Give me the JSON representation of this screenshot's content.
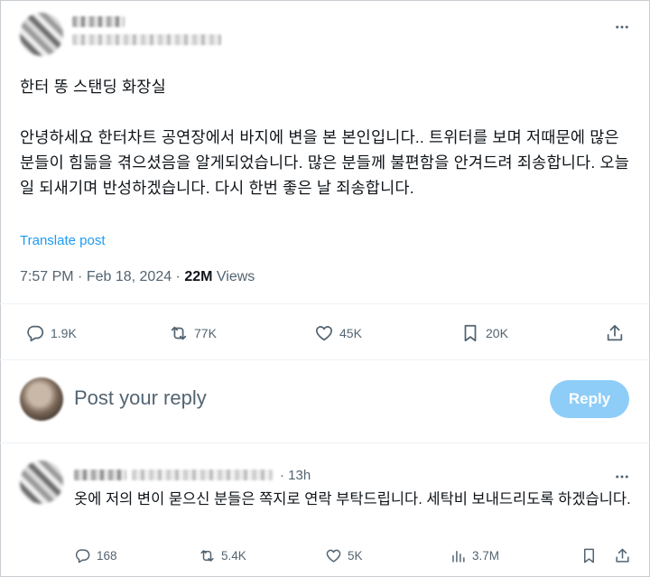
{
  "post": {
    "title": "한터 똥 스탠딩 화장실",
    "body": "안녕하세요 한터차트 공연장에서 바지에 변을 본 본인입니다.. 트위터를 보며 저때문에 많은 분들이 힘듦을 겪으셨음을 알게되었습니다. 많은 분들께 불편함을 안겨드려 죄송합니다. 오늘 일 되새기며 반성하겠습니다. 다시 한번 좋은 날 죄송합니다.",
    "translate_label": "Translate post",
    "time": "7:57 PM",
    "date": "Feb 18, 2024",
    "views_count": "22M",
    "views_label": "Views",
    "replies": "1.9K",
    "reposts": "77K",
    "likes": "45K",
    "bookmarks": "20K"
  },
  "composer": {
    "placeholder": "Post your reply",
    "reply_label": "Reply"
  },
  "reply": {
    "time": "13h",
    "text": "옷에 저의 변이 묻으신 분들은 쪽지로 연락 부탁드립니다. 세탁비 보내드리도록 하겠습니다.",
    "replies": "168",
    "reposts": "5.4K",
    "likes": "5K",
    "views": "3.7M"
  },
  "colors": {
    "accent": "#1d9bf0",
    "reply_button": "#8ecdf8",
    "secondary_text": "#536471"
  },
  "icons": [
    "more-icon",
    "reply-icon",
    "repost-icon",
    "like-icon",
    "bookmark-icon",
    "share-icon",
    "views-icon"
  ]
}
